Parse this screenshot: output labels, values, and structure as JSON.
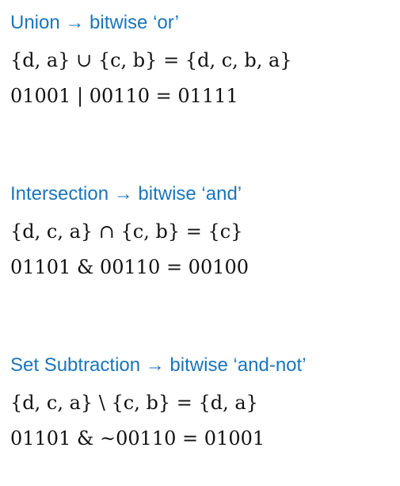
{
  "sections": [
    {
      "heading": "Union → bitwise ‘or’",
      "set_expr": "{d, a} ∪ {c, b} = {d, c, b, a}",
      "bit_expr": "01001 | 00110 = 01111"
    },
    {
      "heading": "Intersection → bitwise ‘and’",
      "set_expr": "{d, c, a} ∩ {c, b} = {c}",
      "bit_expr": "01101 & 00110 = 00100"
    },
    {
      "heading": "Set Subtraction → bitwise ‘and-not’",
      "set_expr": "{d, c, a} \\ {c, b} = {d, a}",
      "bit_expr": "01101 & ~00110 = 01001"
    }
  ],
  "colors": {
    "heading": "#1b75bc",
    "text": "#111111"
  }
}
